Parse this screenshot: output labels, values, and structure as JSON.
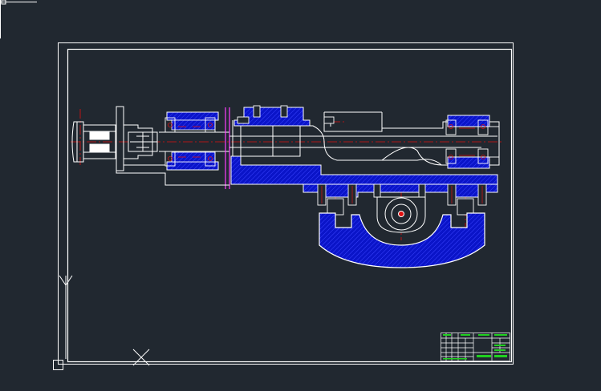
{
  "colors": {
    "background": "#212830",
    "line": "#ffffff",
    "hatch": "#0a14c8",
    "centerline": "#e01010",
    "accent": "#ff40ff",
    "title_green": "#20d020"
  },
  "icons": {
    "ucs_icon": "ucs-axis-icon",
    "cursor_icon": "crosshair-cursor-icon"
  },
  "title_block": {
    "cells": []
  }
}
